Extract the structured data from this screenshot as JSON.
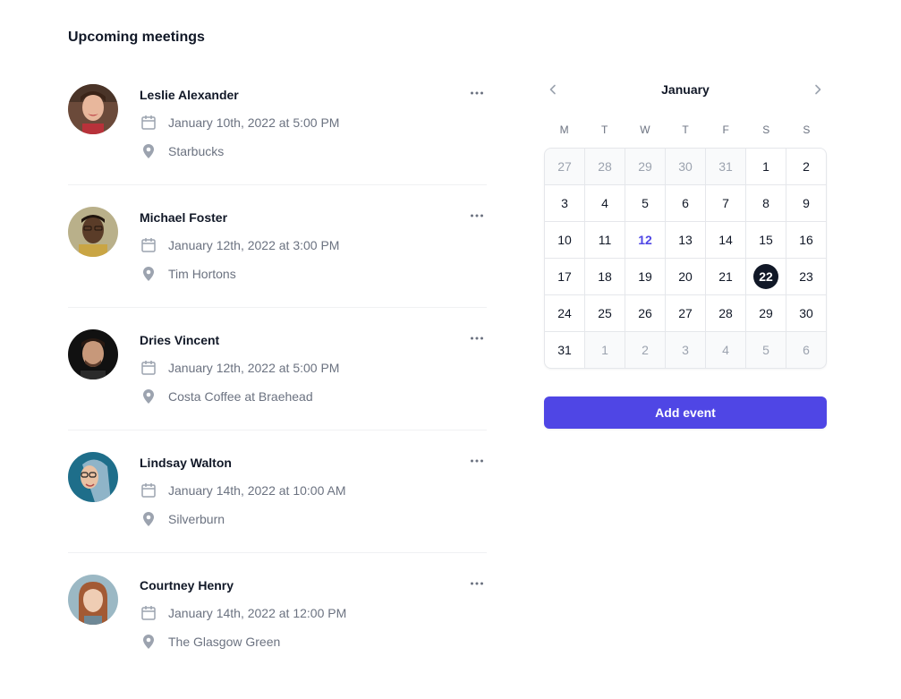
{
  "page_title": "Upcoming meetings",
  "meetings": [
    {
      "name": "Leslie Alexander",
      "datetime": "January 10th, 2022 at 5:00 PM",
      "location": "Starbucks"
    },
    {
      "name": "Michael Foster",
      "datetime": "January 12th, 2022 at 3:00 PM",
      "location": "Tim Hortons"
    },
    {
      "name": "Dries Vincent",
      "datetime": "January 12th, 2022 at 5:00 PM",
      "location": "Costa Coffee at Braehead"
    },
    {
      "name": "Lindsay Walton",
      "datetime": "January 14th, 2022 at 10:00 AM",
      "location": "Silverburn"
    },
    {
      "name": "Courtney Henry",
      "datetime": "January 14th, 2022 at 12:00 PM",
      "location": "The Glasgow Green"
    }
  ],
  "calendar": {
    "month": "January",
    "weekdays": [
      "M",
      "T",
      "W",
      "T",
      "F",
      "S",
      "S"
    ],
    "days": [
      {
        "label": "27",
        "outside": true
      },
      {
        "label": "28",
        "outside": true
      },
      {
        "label": "29",
        "outside": true
      },
      {
        "label": "30",
        "outside": true
      },
      {
        "label": "31",
        "outside": true
      },
      {
        "label": "1"
      },
      {
        "label": "2"
      },
      {
        "label": "3"
      },
      {
        "label": "4"
      },
      {
        "label": "5"
      },
      {
        "label": "6"
      },
      {
        "label": "7"
      },
      {
        "label": "8"
      },
      {
        "label": "9"
      },
      {
        "label": "10"
      },
      {
        "label": "11"
      },
      {
        "label": "12",
        "today": true
      },
      {
        "label": "13"
      },
      {
        "label": "14"
      },
      {
        "label": "15"
      },
      {
        "label": "16"
      },
      {
        "label": "17"
      },
      {
        "label": "18"
      },
      {
        "label": "19"
      },
      {
        "label": "20"
      },
      {
        "label": "21"
      },
      {
        "label": "22",
        "selected": true
      },
      {
        "label": "23"
      },
      {
        "label": "24"
      },
      {
        "label": "25"
      },
      {
        "label": "26"
      },
      {
        "label": "27"
      },
      {
        "label": "28"
      },
      {
        "label": "29"
      },
      {
        "label": "30"
      },
      {
        "label": "31"
      },
      {
        "label": "1",
        "outside": true
      },
      {
        "label": "2",
        "outside": true
      },
      {
        "label": "3",
        "outside": true
      },
      {
        "label": "4",
        "outside": true
      },
      {
        "label": "5",
        "outside": true
      },
      {
        "label": "6",
        "outside": true
      }
    ]
  },
  "add_event_label": "Add event",
  "icons": {
    "calendar": "calendar-icon",
    "location": "map-pin-icon",
    "more": "ellipsis-horizontal-icon",
    "prev": "chevron-left-icon",
    "next": "chevron-right-icon"
  },
  "colors": {
    "accent": "#4f46e5",
    "selected_day": "#111827",
    "muted_text": "#6b7280",
    "icon": "#9ca3af"
  }
}
